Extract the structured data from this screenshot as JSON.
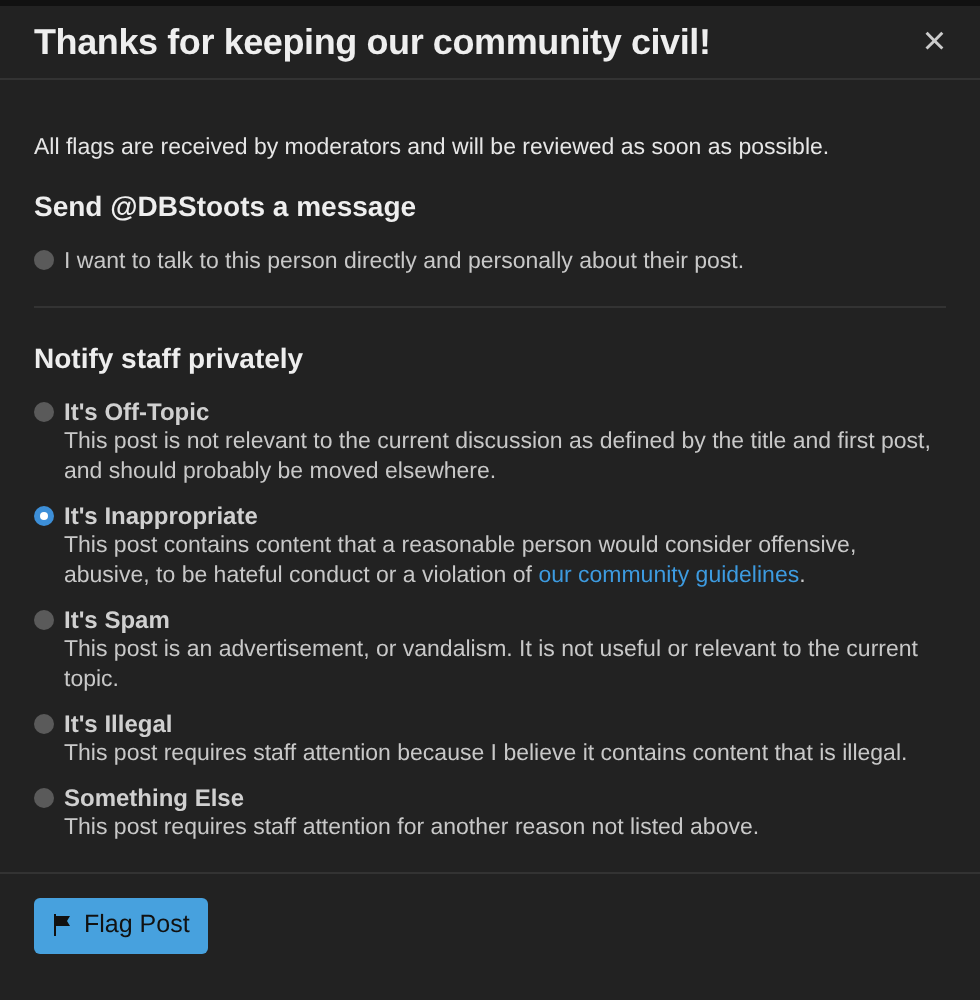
{
  "dialog": {
    "title": "Thanks for keeping our community civil!",
    "close": "×"
  },
  "intro": "All flags are received by moderators and will be reviewed as soon as possible.",
  "message_section": {
    "heading": "Send @DBStoots a message",
    "option": {
      "label": "I want to talk to this person directly and personally about their post.",
      "selected": false
    }
  },
  "staff_section": {
    "heading": "Notify staff privately",
    "options": [
      {
        "title": "It's Off-Topic",
        "description": "This post is not relevant to the current discussion as defined by the title and first post, and should probably be moved elsewhere.",
        "selected": false
      },
      {
        "title": "It's Inappropriate",
        "description": "This post contains content that a reasonable person would consider offensive, abusive, to be hateful conduct or a violation of ",
        "link": "our community guidelines",
        "after": ".",
        "selected": true
      },
      {
        "title": "It's Spam",
        "description": "This post is an advertisement, or vandalism. It is not useful or relevant to the current topic.",
        "selected": false
      },
      {
        "title": "It's Illegal",
        "description": "This post requires staff attention because I believe it contains content that is illegal.",
        "selected": false
      },
      {
        "title": "Something Else",
        "description": "This post requires staff attention for another reason not listed above.",
        "selected": false
      }
    ]
  },
  "footer": {
    "button": "Flag Post"
  }
}
